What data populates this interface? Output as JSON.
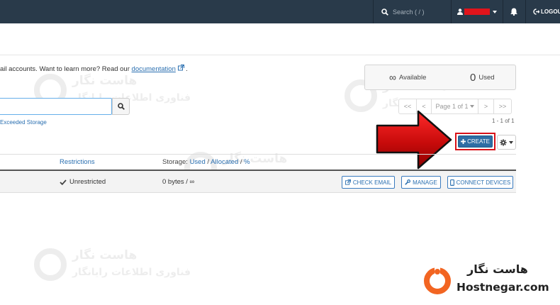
{
  "navbar": {
    "search_placeholder": "Search ( / )",
    "logout_label": "LOGOUT"
  },
  "intro": {
    "text": "ail accounts. Want to learn more? Read our ",
    "link_label": "documentation",
    "suffix": "."
  },
  "stats": {
    "available_symbol": "∞",
    "available_label": "Available",
    "used_count": "0",
    "used_label": "Used"
  },
  "search": {
    "value": "",
    "exceeded_link": "Exceeded Storage"
  },
  "pagination": {
    "first": "<<",
    "prev": "<",
    "page_label": "Page 1 of 1",
    "next": ">",
    "last": ">>",
    "range": "1 - 1 of 1"
  },
  "toolbar": {
    "create_label": "CREATE"
  },
  "table": {
    "headers": {
      "restrictions": "Restrictions",
      "storage_prefix": "Storage:",
      "used": "Used",
      "sep1": " / ",
      "allocated": "Allocated",
      "sep2": " / ",
      "percent": "%"
    },
    "rows": [
      {
        "restrictions": "Unrestricted",
        "storage": "0 bytes / ∞",
        "actions": {
          "check_email": "CHECK EMAIL",
          "manage": "MANAGE",
          "connect_devices": "CONNECT DEVICES"
        }
      }
    ]
  },
  "watermark": {
    "line1": "هاست نگار",
    "line2": "فناوری اطلاعات رایانگار"
  },
  "brand": {
    "name_fa": "هاست نگار",
    "name_en": "Hostnegar.com"
  },
  "colors": {
    "navbar_bg": "#293a4a",
    "primary": "#2e6da4",
    "link": "#2a6fb0",
    "highlight_red": "#d81118",
    "brand_orange": "#f26522"
  }
}
